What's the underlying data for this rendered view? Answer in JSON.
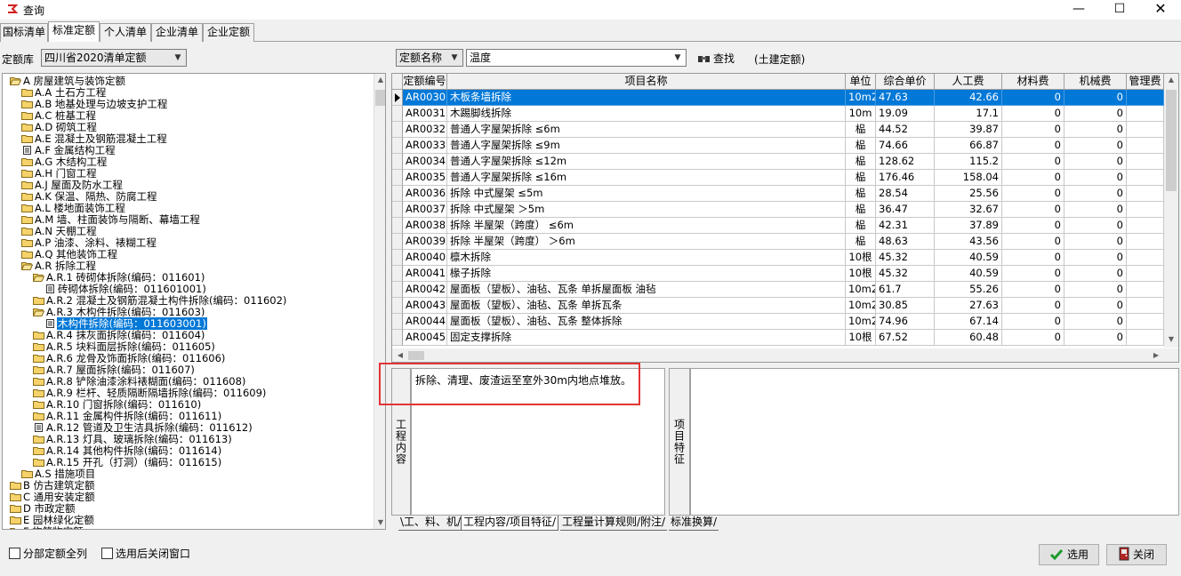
{
  "window": {
    "title": "查询"
  },
  "tabs": [
    "国标清单",
    "标准定额",
    "个人清单",
    "企业清单",
    "企业定额"
  ],
  "library": {
    "label": "定额库",
    "value": "四川省2020清单定额"
  },
  "tree": [
    {
      "depth": 0,
      "text": "A 房屋建筑与装饰定额",
      "icon": "folder-open-icon"
    },
    {
      "depth": 1,
      "text": "A.A 土石方工程",
      "icon": "folder-icon"
    },
    {
      "depth": 1,
      "text": "A.B 地基处理与边坡支护工程",
      "icon": "folder-icon"
    },
    {
      "depth": 1,
      "text": "A.C 桩基工程",
      "icon": "folder-icon"
    },
    {
      "depth": 1,
      "text": "A.D 砌筑工程",
      "icon": "folder-icon"
    },
    {
      "depth": 1,
      "text": "A.E 混凝土及钢筋混凝土工程",
      "icon": "folder-icon"
    },
    {
      "depth": 1,
      "text": "A.F 金属结构工程",
      "icon": "document-icon"
    },
    {
      "depth": 1,
      "text": "A.G 木结构工程",
      "icon": "folder-icon"
    },
    {
      "depth": 1,
      "text": "A.H 门窗工程",
      "icon": "folder-icon"
    },
    {
      "depth": 1,
      "text": "A.J 屋面及防水工程",
      "icon": "folder-icon"
    },
    {
      "depth": 1,
      "text": "A.K 保温、隔热、防腐工程",
      "icon": "folder-icon"
    },
    {
      "depth": 1,
      "text": "A.L 楼地面装饰工程",
      "icon": "folder-icon"
    },
    {
      "depth": 1,
      "text": "A.M 墙、柱面装饰与隔断、幕墙工程",
      "icon": "folder-icon"
    },
    {
      "depth": 1,
      "text": "A.N 天棚工程",
      "icon": "folder-icon"
    },
    {
      "depth": 1,
      "text": "A.P 油漆、涂料、裱糊工程",
      "icon": "folder-icon"
    },
    {
      "depth": 1,
      "text": "A.Q 其他装饰工程",
      "icon": "folder-icon"
    },
    {
      "depth": 1,
      "text": "A.R 拆除工程",
      "icon": "folder-open-icon"
    },
    {
      "depth": 2,
      "text": "A.R.1 砖砌体拆除(编码：011601)",
      "icon": "folder-open-icon"
    },
    {
      "depth": 3,
      "text": "砖砌体拆除(编码：011601001)",
      "icon": "document-icon"
    },
    {
      "depth": 2,
      "text": "A.R.2 混凝土及钢筋混凝土构件拆除(编码：011602)",
      "icon": "folder-icon"
    },
    {
      "depth": 2,
      "text": "A.R.3 木构件拆除(编码：011603)",
      "icon": "folder-open-icon"
    },
    {
      "depth": 3,
      "text": "木构件拆除(编码：011603001)",
      "icon": "document-icon",
      "selected": true
    },
    {
      "depth": 2,
      "text": "A.R.4 抹灰面拆除(编码：011604)",
      "icon": "folder-icon"
    },
    {
      "depth": 2,
      "text": "A.R.5 块料面层拆除(编码：011605)",
      "icon": "folder-icon"
    },
    {
      "depth": 2,
      "text": "A.R.6 龙骨及饰面拆除(编码：011606)",
      "icon": "folder-icon"
    },
    {
      "depth": 2,
      "text": "A.R.7 屋面拆除(编码：011607)",
      "icon": "folder-icon"
    },
    {
      "depth": 2,
      "text": "A.R.8 铲除油漆涂料裱糊面(编码：011608)",
      "icon": "folder-icon"
    },
    {
      "depth": 2,
      "text": "A.R.9 栏杆、轻质隔断隔墙拆除(编码：011609)",
      "icon": "folder-icon"
    },
    {
      "depth": 2,
      "text": "A.R.10 门窗拆除(编码：011610)",
      "icon": "folder-icon"
    },
    {
      "depth": 2,
      "text": "A.R.11 金属构件拆除(编码：011611)",
      "icon": "folder-icon"
    },
    {
      "depth": 2,
      "text": "A.R.12 管道及卫生洁具拆除(编码：011612)",
      "icon": "document-icon"
    },
    {
      "depth": 2,
      "text": "A.R.13 灯具、玻璃拆除(编码：011613)",
      "icon": "folder-icon"
    },
    {
      "depth": 2,
      "text": "A.R.14 其他构件拆除(编码：011614)",
      "icon": "folder-icon"
    },
    {
      "depth": 2,
      "text": "A.R.15 开孔（打洞）(编码：011615)",
      "icon": "folder-icon"
    },
    {
      "depth": 1,
      "text": "A.S 措施项目",
      "icon": "folder-icon"
    },
    {
      "depth": 0,
      "text": "B 仿古建筑定额",
      "icon": "folder-icon"
    },
    {
      "depth": 0,
      "text": "C 通用安装定额",
      "icon": "folder-icon"
    },
    {
      "depth": 0,
      "text": "D 市政定额",
      "icon": "folder-icon"
    },
    {
      "depth": 0,
      "text": "E 园林绿化定额",
      "icon": "folder-icon"
    },
    {
      "depth": 0,
      "text": "F 构筑物定额",
      "icon": "folder-icon"
    }
  ],
  "search": {
    "field": "定额名称",
    "value": "温度",
    "find_label": "查找",
    "scope": "(土建定额)"
  },
  "grid": {
    "columns": [
      "定额编号",
      "项目名称",
      "单位",
      "综合单价",
      "人工费",
      "材料费",
      "机械费",
      "管理费"
    ],
    "rows": [
      [
        "AR0030",
        "木板条墙拆除",
        "10m2",
        "47.63",
        "42.66",
        "0",
        "0"
      ],
      [
        "AR0031",
        "木踢脚线拆除",
        "10m",
        "19.09",
        "17.1",
        "0",
        "0"
      ],
      [
        "AR0032",
        "普通人字屋架拆除 ≤6m",
        "榀",
        "44.52",
        "39.87",
        "0",
        "0"
      ],
      [
        "AR0033",
        "普通人字屋架拆除 ≤9m",
        "榀",
        "74.66",
        "66.87",
        "0",
        "0"
      ],
      [
        "AR0034",
        "普通人字屋架拆除 ≤12m",
        "榀",
        "128.62",
        "115.2",
        "0",
        "0"
      ],
      [
        "AR0035",
        "普通人字屋架拆除 ≤16m",
        "榀",
        "176.46",
        "158.04",
        "0",
        "0"
      ],
      [
        "AR0036",
        "拆除 中式屋架 ≤5m",
        "榀",
        "28.54",
        "25.56",
        "0",
        "0"
      ],
      [
        "AR0037",
        "拆除 中式屋架 ＞5m",
        "榀",
        "36.47",
        "32.67",
        "0",
        "0"
      ],
      [
        "AR0038",
        "拆除 半屋架（跨度） ≤6m",
        "榀",
        "42.31",
        "37.89",
        "0",
        "0"
      ],
      [
        "AR0039",
        "拆除 半屋架（跨度） ＞6m",
        "榀",
        "48.63",
        "43.56",
        "0",
        "0"
      ],
      [
        "AR0040",
        "檩木拆除",
        "10根",
        "45.32",
        "40.59",
        "0",
        "0"
      ],
      [
        "AR0041",
        "椽子拆除",
        "10根",
        "45.32",
        "40.59",
        "0",
        "0"
      ],
      [
        "AR0042",
        "屋面板（望板）、油毡、瓦条 单拆屋面板 油毡",
        "10m2",
        "61.7",
        "55.26",
        "0",
        "0"
      ],
      [
        "AR0043",
        "屋面板（望板）、油毡、瓦条 单拆瓦条",
        "10m2",
        "30.85",
        "27.63",
        "0",
        "0"
      ],
      [
        "AR0044",
        "屋面板（望板）、油毡、瓦条 整体拆除",
        "10m2",
        "74.96",
        "67.14",
        "0",
        "0"
      ],
      [
        "AR0045",
        "固定支撑拆除",
        "10根",
        "67.52",
        "60.48",
        "0",
        "0"
      ]
    ]
  },
  "work_content": {
    "label": "工程内容",
    "text": "拆除、清理、废渣运至室外30m内地点堆放。"
  },
  "feature": {
    "label": "项目特征",
    "text": ""
  },
  "bottom_tabs": [
    "工、料、机",
    "工程内容/项目特征",
    "工程量计算规则/附注",
    "标准换算"
  ],
  "options": {
    "show_all": "分部定额全列",
    "close_after": "选用后关闭窗口"
  },
  "buttons": {
    "select": "选用",
    "close": "关闭"
  }
}
